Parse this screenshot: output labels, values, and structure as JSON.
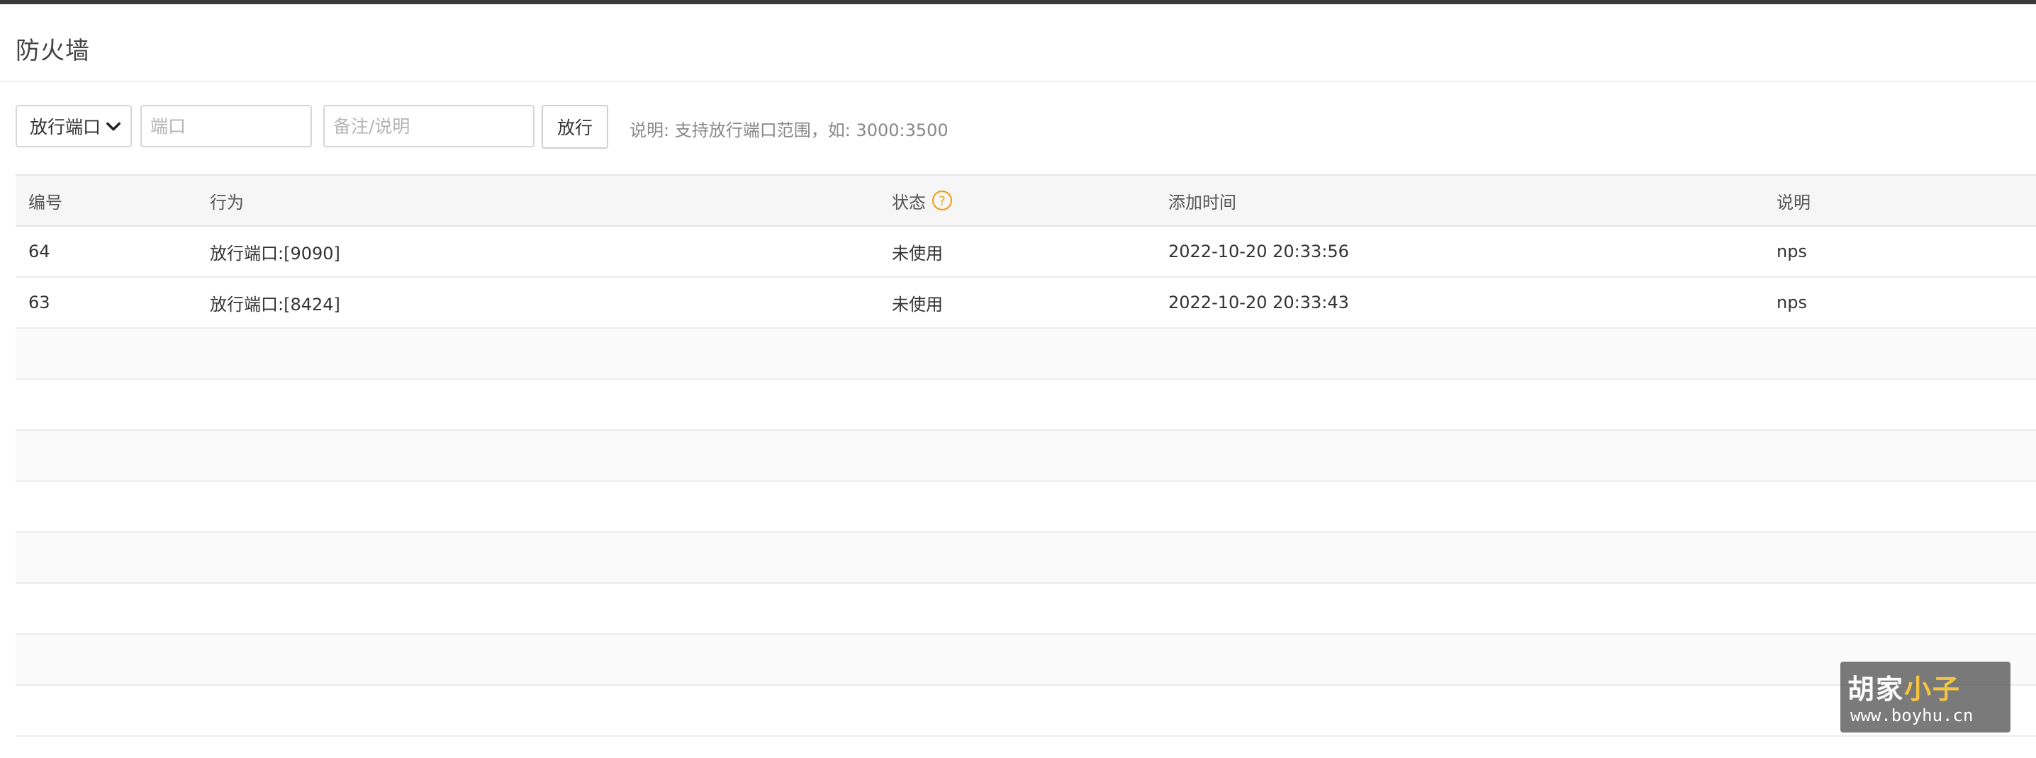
{
  "page": {
    "title": "防火墙"
  },
  "toolbar": {
    "type_select": {
      "selected": "放行端口",
      "options": [
        "放行端口"
      ]
    },
    "port_input": {
      "value": "",
      "placeholder": "端口"
    },
    "note_input": {
      "value": "",
      "placeholder": "备注/说明"
    },
    "submit_label": "放行",
    "hint": "说明: 支持放行端口范围，如: 3000:3500"
  },
  "table": {
    "columns": [
      "编号",
      "行为",
      "状态",
      "添加时间",
      "说明"
    ],
    "rows": [
      {
        "id": "64",
        "action": "放行端口:[9090]",
        "state": "未使用",
        "time": "2022-10-20 20:33:56",
        "desc": "nps"
      },
      {
        "id": "63",
        "action": "放行端口:[8424]",
        "state": "未使用",
        "time": "2022-10-20 20:33:43",
        "desc": "nps"
      },
      {
        "id": "",
        "action": "",
        "state": "",
        "time": "",
        "desc": ""
      },
      {
        "id": "",
        "action": "",
        "state": "",
        "time": "",
        "desc": ""
      },
      {
        "id": "",
        "action": "",
        "state": "",
        "time": "",
        "desc": ""
      },
      {
        "id": "",
        "action": "",
        "state": "",
        "time": "",
        "desc": ""
      },
      {
        "id": "",
        "action": "",
        "state": "",
        "time": "",
        "desc": ""
      },
      {
        "id": "",
        "action": "",
        "state": "",
        "time": "",
        "desc": ""
      },
      {
        "id": "",
        "action": "",
        "state": "",
        "time": "",
        "desc": ""
      },
      {
        "id": "",
        "action": "",
        "state": "",
        "time": "",
        "desc": ""
      }
    ]
  },
  "watermark": {
    "brand_part1": "胡家",
    "brand_part2": "小子",
    "url": "www.boyhu.cn"
  },
  "colors": {
    "help_icon": "#f0a020",
    "header_bg": "#f6f6f6",
    "watermark_accent": "#f5c542"
  },
  "icons": {
    "select_chevron": "chevron-down-icon",
    "state_help": "question-circle-icon"
  }
}
